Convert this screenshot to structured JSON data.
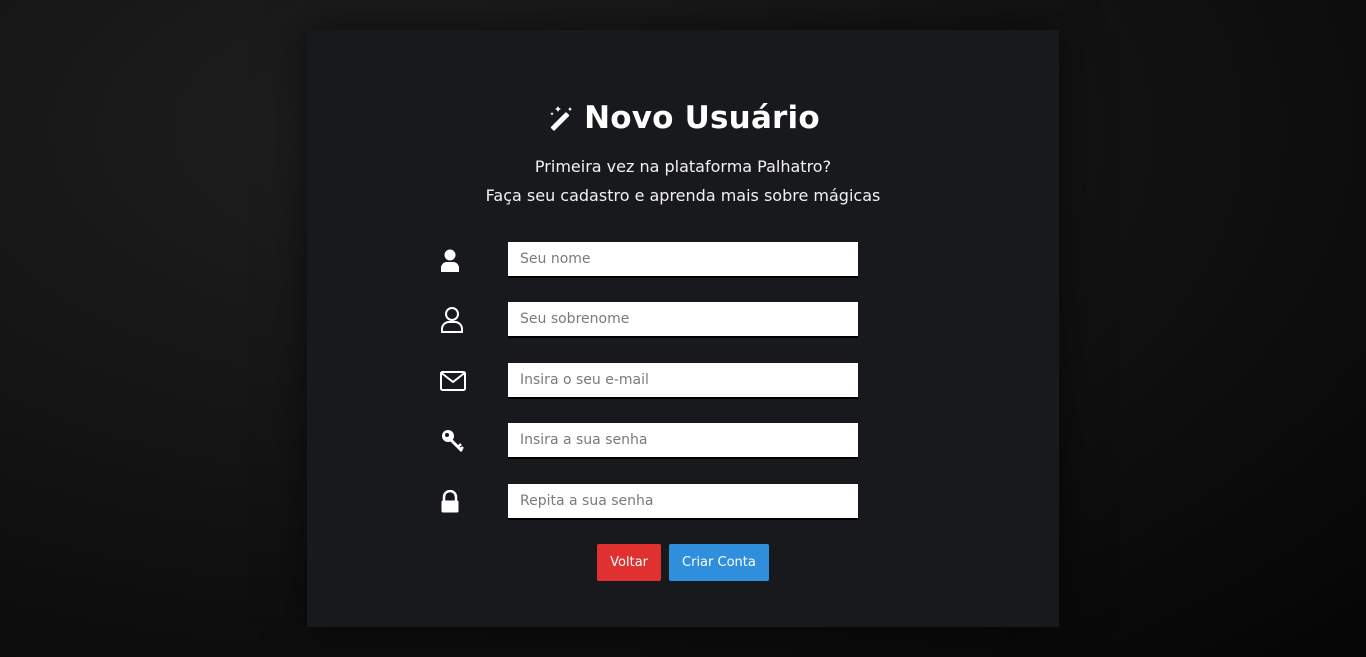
{
  "form": {
    "title": "Novo Usuário",
    "subtitle_line1": "Primeira vez na plataforma Palhatro?",
    "subtitle_line2": "Faça seu cadastro e aprenda mais sobre mágicas",
    "fields": [
      {
        "icon": "user-solid-icon",
        "placeholder": "Seu nome",
        "value": ""
      },
      {
        "icon": "user-outline-icon",
        "placeholder": "Seu sobrenome",
        "value": ""
      },
      {
        "icon": "envelope-icon",
        "placeholder": "Insira o seu e-mail",
        "value": ""
      },
      {
        "icon": "key-icon",
        "placeholder": "Insira a sua senha",
        "value": ""
      },
      {
        "icon": "lock-icon",
        "placeholder": "Repita a sua senha",
        "value": ""
      }
    ],
    "back_label": "Voltar",
    "create_label": "Criar Conta"
  },
  "colors": {
    "card_bg": "#18191d",
    "back_button": "#e03030",
    "create_button": "#2f8fdd"
  }
}
